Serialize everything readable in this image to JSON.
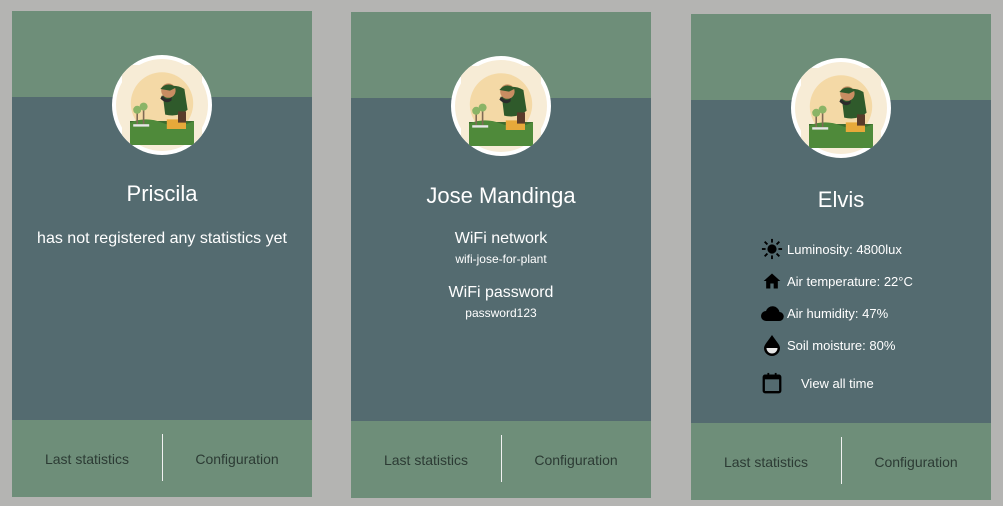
{
  "cards": [
    {
      "name": "Priscila",
      "message": "has not registered any statistics yet",
      "footer": {
        "left": "Last statistics",
        "right": "Configuration"
      }
    },
    {
      "name": "Jose Mandinga",
      "wifi_network_label": "WiFi network",
      "wifi_network_value": "wifi-jose-for-plant",
      "wifi_password_label": "WiFi password",
      "wifi_password_value": "password123",
      "footer": {
        "left": "Last statistics",
        "right": "Configuration"
      }
    },
    {
      "name": "Elvis",
      "stats": [
        {
          "icon": "sun-icon",
          "label": "Luminosity: 4800lux"
        },
        {
          "icon": "home-icon",
          "label": "Air temperature: 22°C"
        },
        {
          "icon": "cloud-icon",
          "label": "Air humidity: 47%"
        },
        {
          "icon": "water-drop-icon",
          "label": "Soil moisture: 80%"
        }
      ],
      "view_all_label": "View all time",
      "footer": {
        "left": "Last statistics",
        "right": "Configuration"
      }
    }
  ],
  "colors": {
    "page_background": "#b4b4b2",
    "header_footer": "#6e8e79",
    "card_body": "#546b70",
    "text": "#ffffff",
    "footer_text": "#2c3b34"
  }
}
